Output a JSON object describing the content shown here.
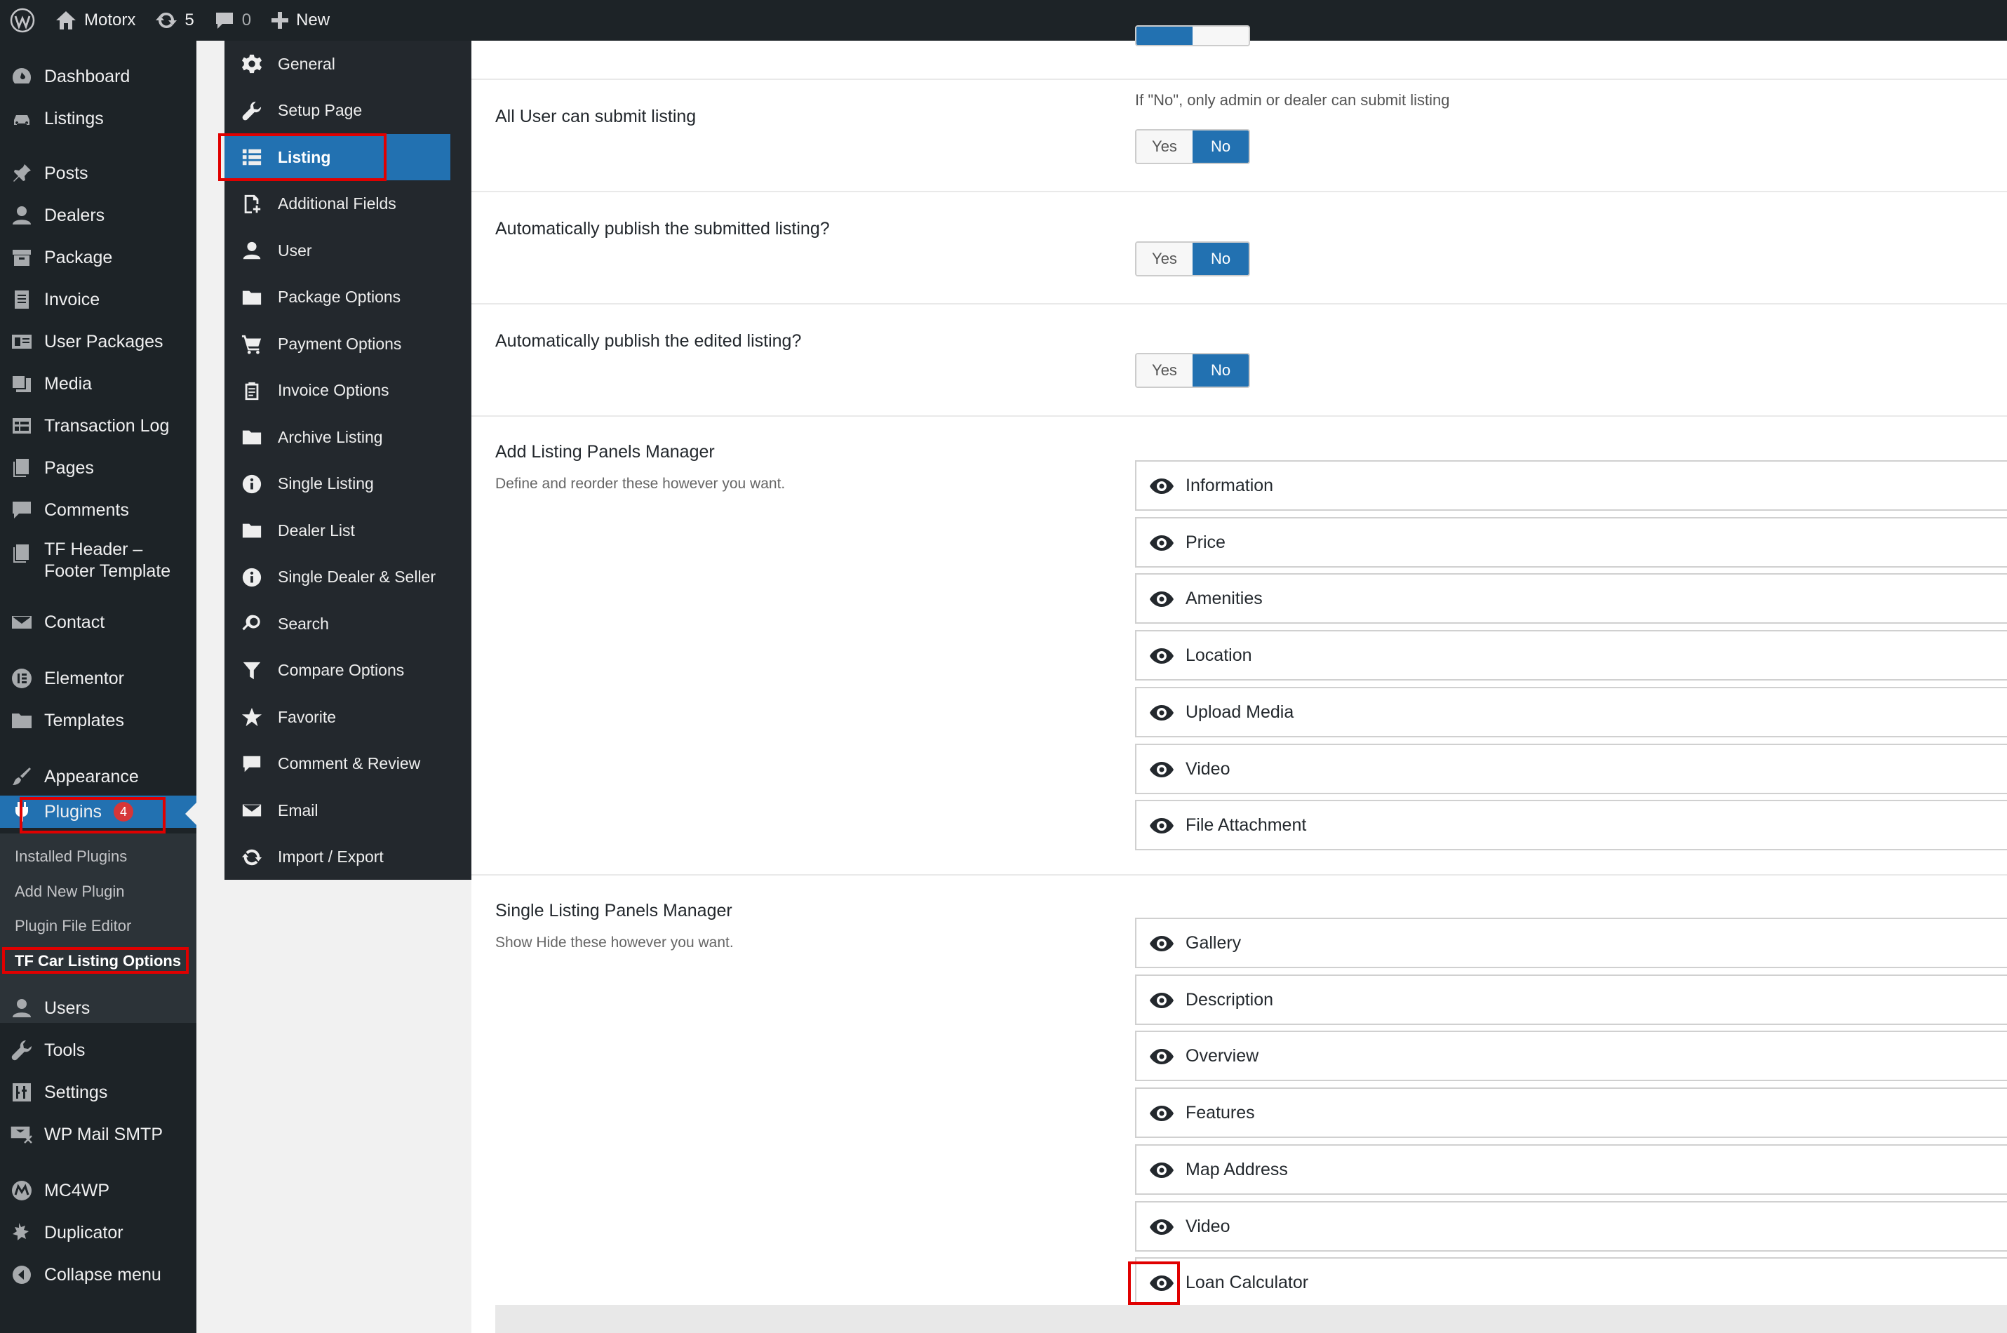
{
  "adminbar": {
    "site_name": "Motorx",
    "updates_count": "5",
    "comments_count": "0",
    "new_label": "New"
  },
  "menu": {
    "items": [
      {
        "label": "Dashboard",
        "icon": "dashboard-icon"
      },
      {
        "label": "Listings",
        "icon": "car-icon"
      },
      {
        "label": "Posts",
        "icon": "pin-icon"
      },
      {
        "label": "Dealers",
        "icon": "user-icon"
      },
      {
        "label": "Package",
        "icon": "archive-icon"
      },
      {
        "label": "Invoice",
        "icon": "document-icon"
      },
      {
        "label": "User Packages",
        "icon": "id-card-icon"
      },
      {
        "label": "Media",
        "icon": "media-icon"
      },
      {
        "label": "Transaction Log",
        "icon": "table-icon"
      },
      {
        "label": "Pages",
        "icon": "pages-icon"
      },
      {
        "label": "Comments",
        "icon": "comment-icon"
      },
      {
        "label": "TF Header –",
        "label2": "Footer Template",
        "icon": "pages-icon"
      },
      {
        "label": "Contact",
        "icon": "envelope-icon"
      },
      {
        "label": "Elementor",
        "icon": "elementor-icon"
      },
      {
        "label": "Templates",
        "icon": "folder-icon"
      },
      {
        "label": "Appearance",
        "icon": "brush-icon"
      },
      {
        "label": "Plugins",
        "icon": "plugin-icon",
        "badge": "4"
      },
      {
        "label": "Users",
        "icon": "user-icon"
      },
      {
        "label": "Tools",
        "icon": "wrench-icon"
      },
      {
        "label": "Settings",
        "icon": "settings-icon"
      },
      {
        "label": "WP Mail SMTP",
        "icon": "mail-icon"
      },
      {
        "label": "MC4WP",
        "icon": "mc4wp-icon"
      },
      {
        "label": "Duplicator",
        "icon": "duplicator-icon"
      },
      {
        "label": "Collapse menu",
        "icon": "collapse-icon"
      }
    ],
    "plugins_submenu": [
      "Installed Plugins",
      "Add New Plugin",
      "Plugin File Editor",
      "TF Car Listing Options"
    ]
  },
  "options_nav": [
    {
      "label": "General",
      "icon": "gear-icon"
    },
    {
      "label": "Setup Page",
      "icon": "wrench-icon"
    },
    {
      "label": "Listing",
      "icon": "list-icon"
    },
    {
      "label": "Additional Fields",
      "icon": "add-file-icon"
    },
    {
      "label": "User",
      "icon": "user-icon"
    },
    {
      "label": "Package Options",
      "icon": "folder-icon"
    },
    {
      "label": "Payment Options",
      "icon": "cart-icon"
    },
    {
      "label": "Invoice Options",
      "icon": "clipboard-icon"
    },
    {
      "label": "Archive Listing",
      "icon": "folder-icon"
    },
    {
      "label": "Single Listing",
      "icon": "info-icon"
    },
    {
      "label": "Dealer List",
      "icon": "folder-icon"
    },
    {
      "label": "Single Dealer & Seller",
      "icon": "info-icon"
    },
    {
      "label": "Search",
      "icon": "search-icon"
    },
    {
      "label": "Compare Options",
      "icon": "filter-icon"
    },
    {
      "label": "Favorite",
      "icon": "star-icon"
    },
    {
      "label": "Comment & Review",
      "icon": "comment-icon"
    },
    {
      "label": "Email",
      "icon": "envelope-icon"
    },
    {
      "label": "Import / Export",
      "icon": "refresh-icon"
    }
  ],
  "fields": {
    "toggle_yes": "Yes",
    "toggle_no": "No",
    "all_user_submit": {
      "title": "All User can submit listing",
      "hint": "If \"No\", only admin or dealer can submit listing"
    },
    "auto_publish_submitted": {
      "title": "Automatically publish the submitted listing?"
    },
    "auto_publish_edited": {
      "title": "Automatically publish the edited listing?"
    },
    "add_listing_panels": {
      "title": "Add Listing Panels Manager",
      "desc": "Define and reorder these however you want.",
      "items": [
        "Information",
        "Price",
        "Amenities",
        "Location",
        "Upload Media",
        "Video",
        "File Attachment"
      ]
    },
    "single_listing_panels": {
      "title": "Single Listing Panels Manager",
      "desc": "Show Hide these however you want.",
      "items": [
        "Gallery",
        "Description",
        "Overview",
        "Features",
        "Map Address",
        "Video",
        "Loan Calculator"
      ]
    }
  },
  "colors": {
    "admin_bg": "#1d2327",
    "accent": "#2271b1",
    "highlight": "#e00000",
    "badge": "#d63638"
  }
}
